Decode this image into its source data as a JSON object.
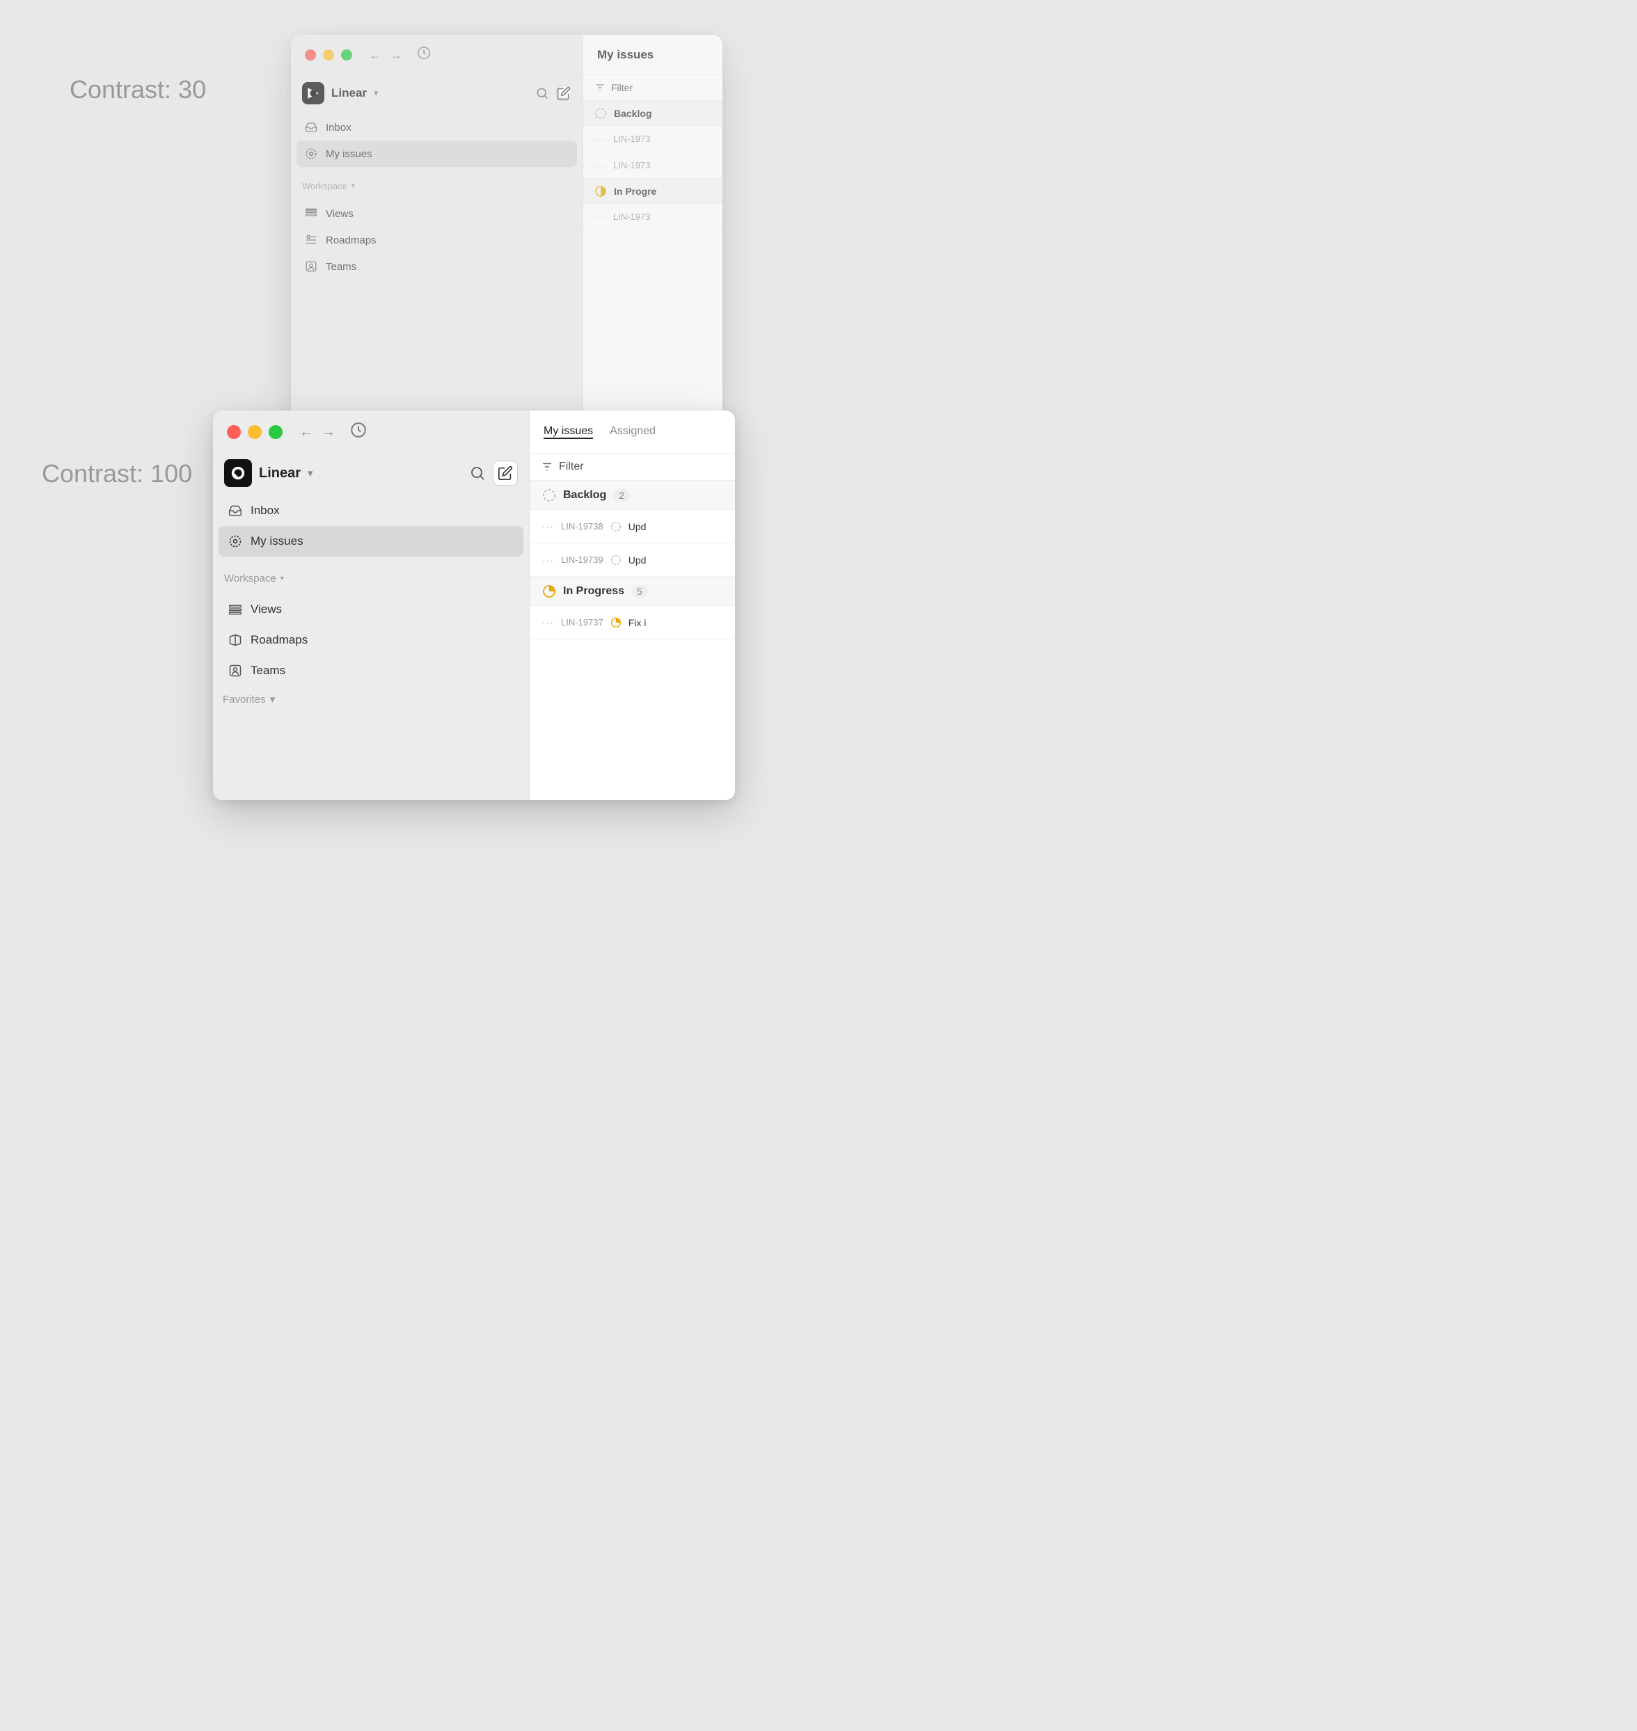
{
  "page": {
    "background": "#e8e8e8",
    "contrast_top_label": "Contrast: 30",
    "contrast_bottom_label": "Contrast: 100"
  },
  "window1": {
    "title": "Linear",
    "brand": {
      "name": "Linear",
      "chevron": "▾"
    },
    "nav": {
      "inbox": "Inbox",
      "my_issues": "My issues"
    },
    "workspace": {
      "label": "Workspace",
      "views": "Views",
      "roadmaps": "Roadmaps",
      "teams": "Teams"
    },
    "main": {
      "title": "My issues",
      "filter_label": "Filter",
      "sections": [
        {
          "id": "backlog",
          "label": "Backlog",
          "count": null,
          "issues": [
            {
              "id": "LIN-1973",
              "title": ""
            },
            {
              "id": "LIN-1973",
              "title": ""
            }
          ]
        },
        {
          "id": "in_progress",
          "label": "In Progre",
          "count": null,
          "issues": [
            {
              "id": "LIN-1973",
              "title": ""
            }
          ]
        }
      ]
    }
  },
  "window2": {
    "title": "Linear",
    "brand": {
      "name": "Linear",
      "chevron": "▾"
    },
    "nav": {
      "inbox": "Inbox",
      "my_issues": "My issues"
    },
    "workspace": {
      "label": "Workspace",
      "views": "Views",
      "roadmaps": "Roadmaps",
      "teams": "Teams"
    },
    "favorites": {
      "label": "Favorites"
    },
    "main": {
      "title": "My issues",
      "tab_assigned": "Assigned",
      "filter_label": "Filter",
      "sections": [
        {
          "id": "backlog",
          "label": "Backlog",
          "count": "2",
          "issues": [
            {
              "id": "LIN-19738",
              "status": "backlog",
              "title": "Upd"
            },
            {
              "id": "LIN-19739",
              "status": "backlog",
              "title": "Upd"
            }
          ]
        },
        {
          "id": "in_progress",
          "label": "In Progress",
          "count": "5",
          "issues": [
            {
              "id": "LIN-19737",
              "status": "in_progress",
              "title": "Fix i"
            }
          ]
        }
      ]
    }
  }
}
